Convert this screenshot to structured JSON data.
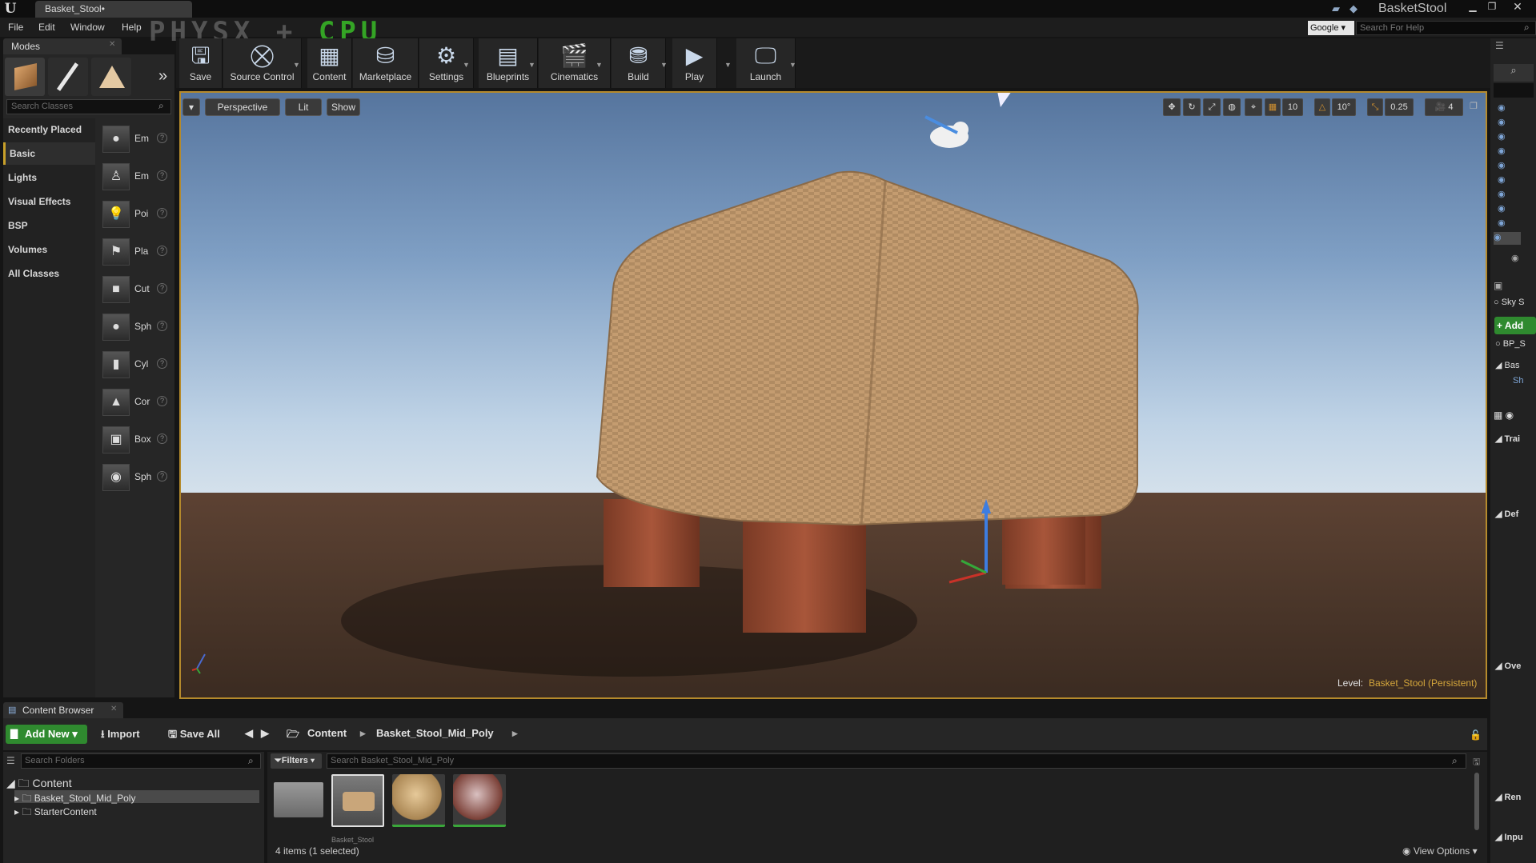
{
  "titlebar": {
    "tab": "Basket_Stool•",
    "app_title": "BasketStool"
  },
  "menu": {
    "items": [
      "File",
      "Edit",
      "Window",
      "Help"
    ]
  },
  "watermark": {
    "physx": "PHYSX",
    "plus": "+",
    "cpu": "CPU"
  },
  "search_engine": "Google",
  "help_search": {
    "placeholder": "Search For Help"
  },
  "modes": {
    "tab": "Modes",
    "search_placeholder": "Search Classes",
    "categories": [
      "Recently Placed",
      "Basic",
      "Lights",
      "Visual Effects",
      "BSP",
      "Volumes",
      "All Classes"
    ],
    "items": [
      "Em",
      "Em",
      "Poi",
      "Pla",
      "Cut",
      "Sph",
      "Cyl",
      "Cor",
      "Box",
      "Sph"
    ]
  },
  "toolbar": {
    "save": "Save",
    "source_control": "Source Control",
    "content": "Content",
    "marketplace": "Marketplace",
    "settings": "Settings",
    "blueprints": "Blueprints",
    "cinematics": "Cinematics",
    "build": "Build",
    "play": "Play",
    "launch": "Launch"
  },
  "viewport": {
    "perspective": "Perspective",
    "lit": "Lit",
    "show": "Show",
    "grid_snap": "10",
    "rot_snap": "10°",
    "scale_snap": "0.25",
    "cam_speed": "4",
    "level_label": "Level:",
    "level_name": "Basket_Stool (Persistent)"
  },
  "details": {
    "sky": "Sky S",
    "add": "+ Add",
    "bp": "BP_S",
    "bas": "Bas",
    "sh": "Sh",
    "sections": [
      "Trai",
      "Def",
      "Ove",
      "Ren",
      "Inpu"
    ]
  },
  "content_browser": {
    "tab": "Content Browser",
    "add_new": "Add New",
    "import": "Import",
    "save_all": "Save All",
    "path": [
      "Content",
      "Basket_Stool_Mid_Poly"
    ],
    "search_folders": "Search Folders",
    "filters": "Filters",
    "search_assets": "Search Basket_Stool_Mid_Poly",
    "tree": [
      "Content",
      "Basket_Stool_Mid_Poly",
      "StarterContent"
    ],
    "asset_caption": "Basket_Stool",
    "status": "4 items (1 selected)",
    "view_options": "View Options"
  }
}
